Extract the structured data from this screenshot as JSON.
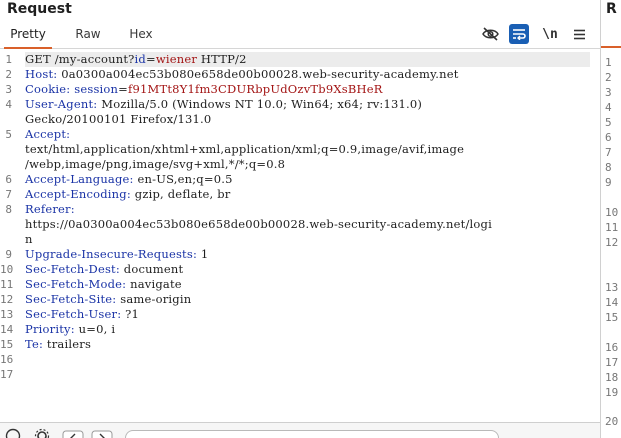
{
  "request_panel": {
    "title": "Request",
    "tabs": [
      {
        "label": "Pretty",
        "active": true
      },
      {
        "label": "Raw",
        "active": false
      },
      {
        "label": "Hex",
        "active": false
      }
    ],
    "toolbar": {
      "newline_label": "\\n",
      "icons": [
        "eye-off-icon",
        "wrap-lines-icon",
        "newline-icon",
        "menu-icon"
      ]
    },
    "gutter": [
      "1",
      "2",
      "3",
      "4",
      "",
      "5",
      "",
      "",
      "6",
      "7",
      "8",
      "",
      "",
      "9",
      "10",
      "11",
      "12",
      "13",
      "14",
      "15",
      "16",
      "17"
    ],
    "lines": {
      "l1_method": "GET /my-account?",
      "l1_pname": "id",
      "l1_eq": "=",
      "l1_pval": "wiener",
      "l1_rest": " HTTP/2",
      "l2_name": "Host:",
      "l2_val": " 0a0300a004ec53b080e658de00b00028.web-security-academy.net",
      "l3_name": "Cookie:",
      "l3_pname": " session",
      "l3_eq": "=",
      "l3_pval": "f91MTt8Y1fm3CDURbpUdOzvTb9XsBHeR",
      "l4_name": "User-Agent:",
      "l4_val": " Mozilla/5.0 (Windows NT 10.0; Win64; x64; rv:131.0)",
      "l4b_val": "Gecko/20100101 Firefox/131.0",
      "l5_name": "Accept:",
      "l5b_val": "text/html,application/xhtml+xml,application/xml;q=0.9,image/avif,image",
      "l5c_val": "/webp,image/png,image/svg+xml,*/*;q=0.8",
      "l6_name": "Accept-Language:",
      "l6_val": " en-US,en;q=0.5",
      "l7_name": "Accept-Encoding:",
      "l7_val": " gzip, deflate, br",
      "l8_name": "Referer:",
      "l8b_val": "https://0a0300a004ec53b080e658de00b00028.web-security-academy.net/logi",
      "l8c_val": "n",
      "l9_name": "Upgrade-Insecure-Requests:",
      "l9_val": " 1",
      "l10_name": "Sec-Fetch-Dest:",
      "l10_val": " document",
      "l11_name": "Sec-Fetch-Mode:",
      "l11_val": " navigate",
      "l12_name": "Sec-Fetch-Site:",
      "l12_val": " same-origin",
      "l13_name": "Sec-Fetch-User:",
      "l13_val": " ?1",
      "l14_name": "Priority:",
      "l14_val": " u=0, i",
      "l15_name": "Te:",
      "l15_val": " trailers"
    }
  },
  "response_panel": {
    "title": "R",
    "gutter": [
      "1",
      "2",
      "3",
      "4",
      "5",
      "6",
      "7",
      "8",
      "9",
      "10",
      "11",
      "12",
      "13",
      "14",
      "15",
      "16",
      "17",
      "18",
      "19",
      "20"
    ]
  },
  "colors": {
    "accent_orange": "#d9602a",
    "header_name_blue": "#1a33a6",
    "param_value_red": "#a31515",
    "selected_tool_blue": "#1a5fb4"
  }
}
